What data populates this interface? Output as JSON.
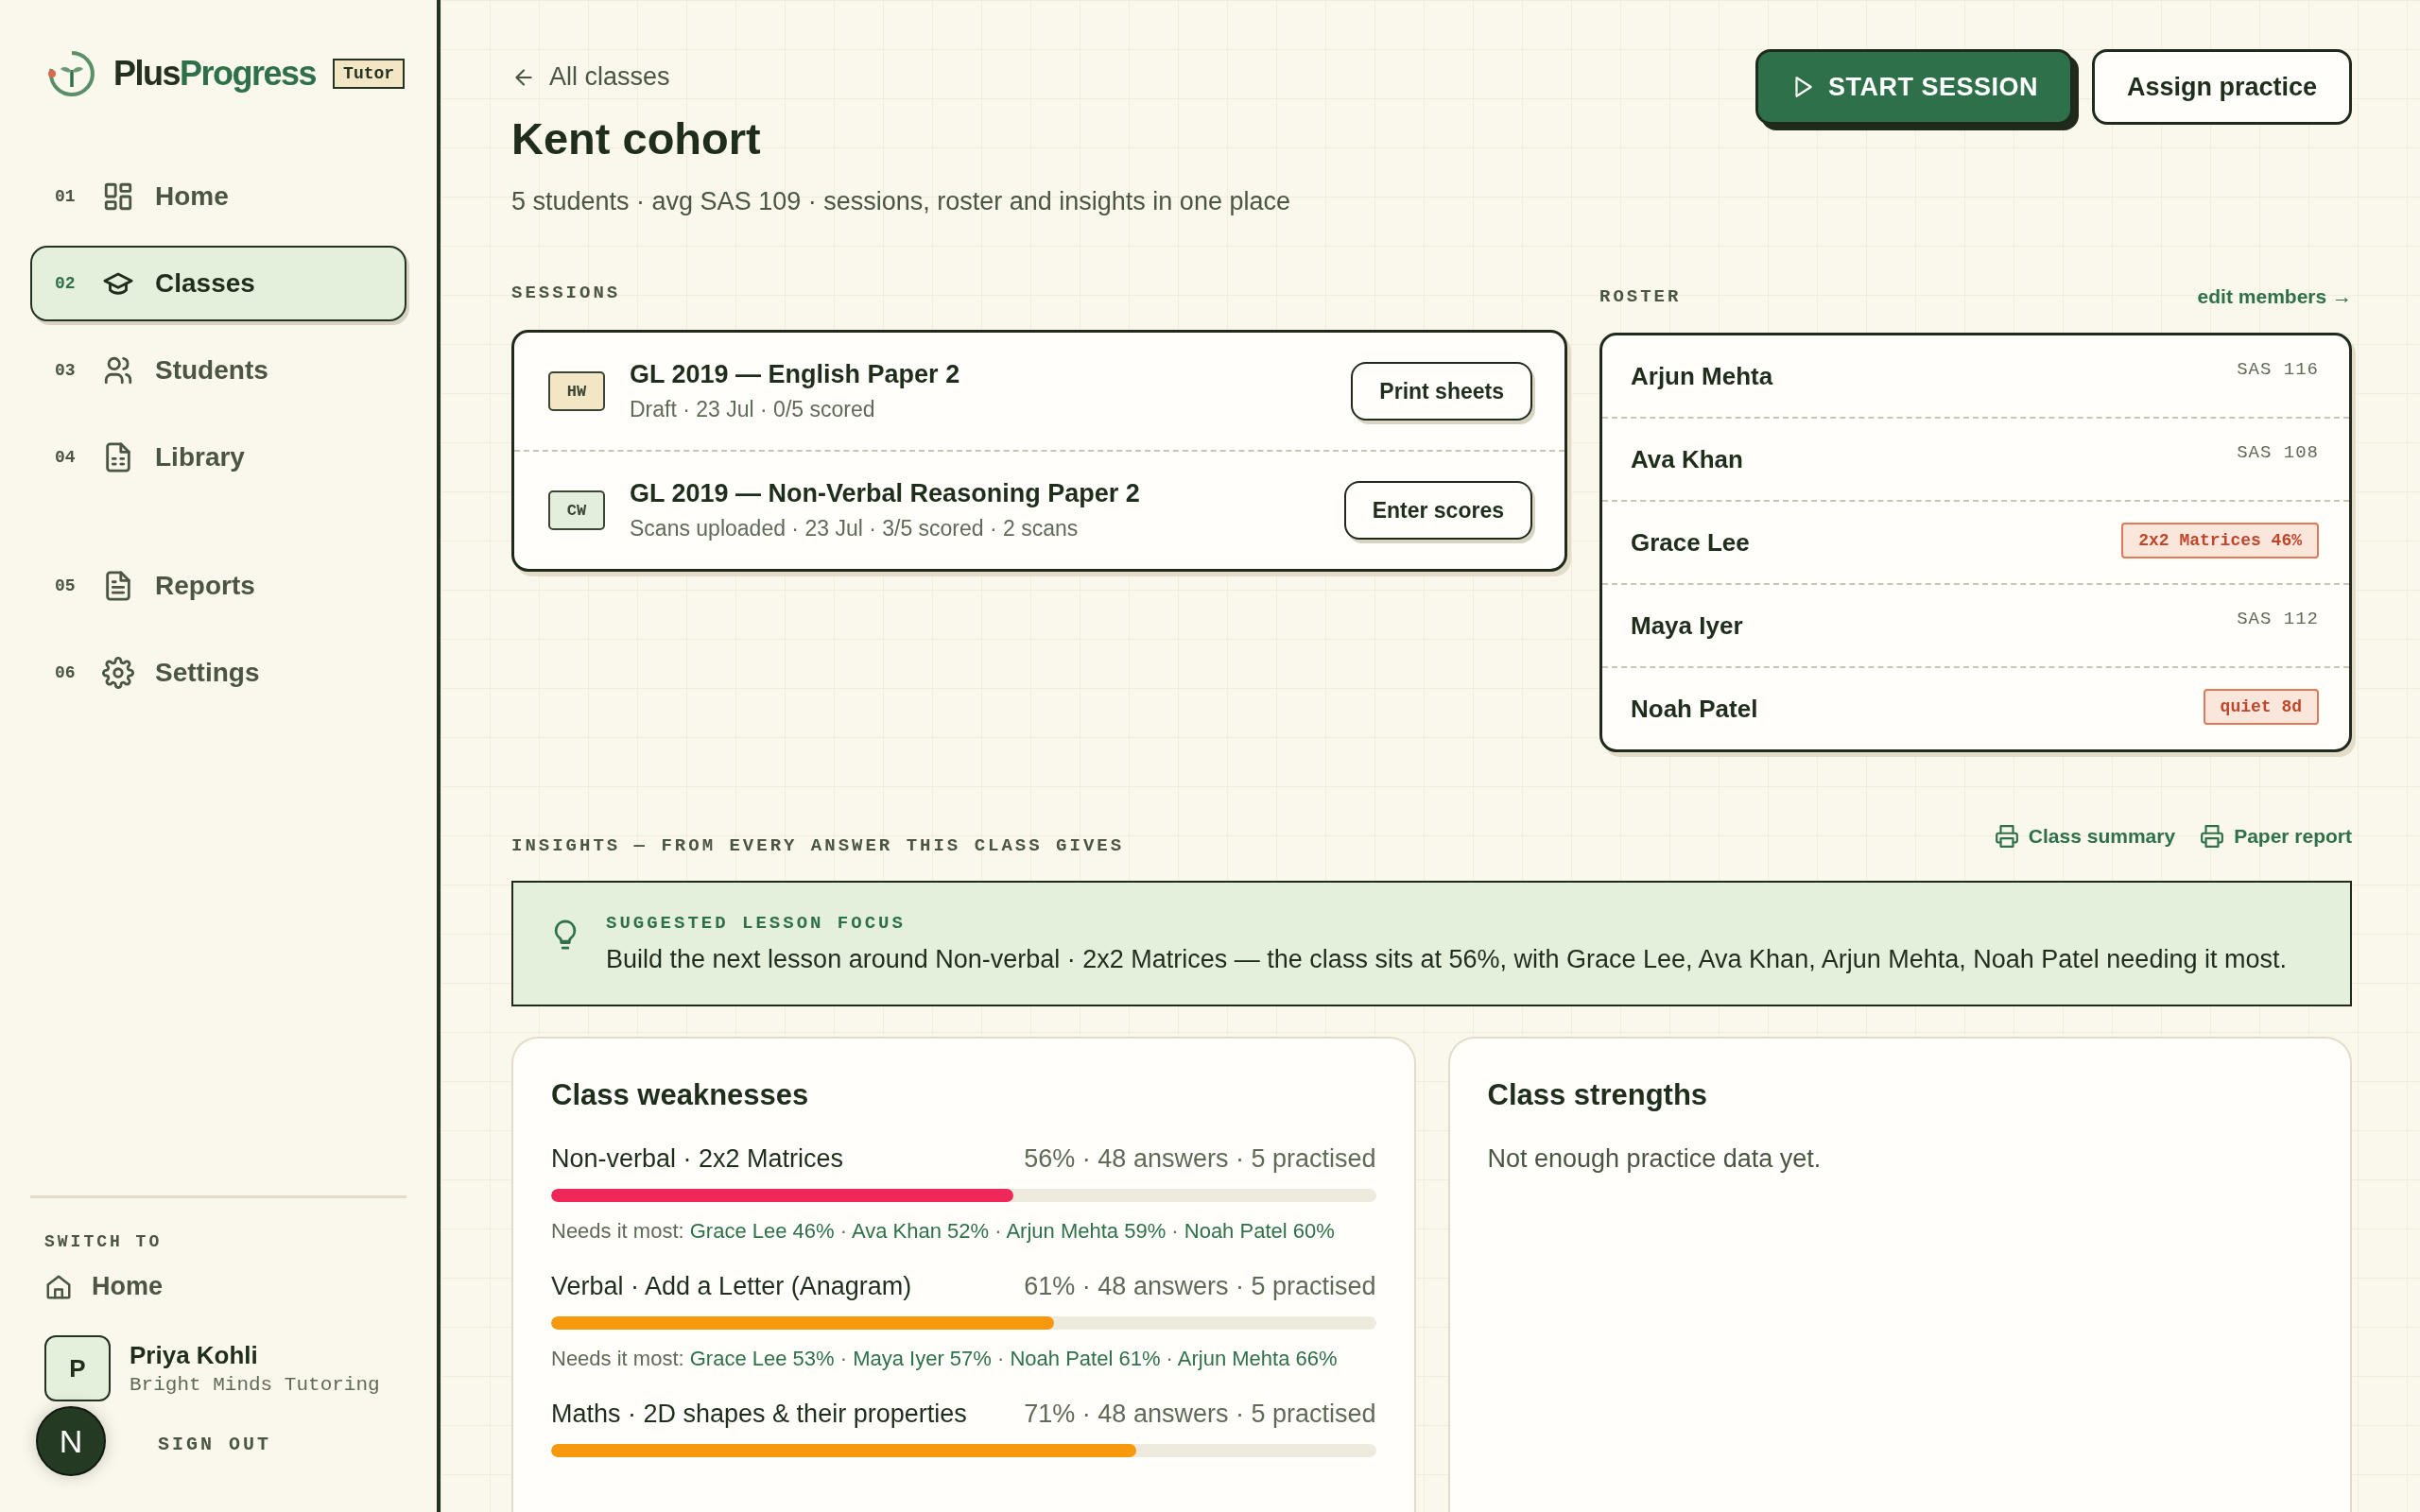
{
  "sidebar": {
    "brand": {
      "name_first": "Plus",
      "name_second": "Progress",
      "badge": "Tutor"
    },
    "nav": [
      {
        "number": "01",
        "label": "Home",
        "kind": "dashboard",
        "selected": false
      },
      {
        "number": "02",
        "label": "Classes",
        "kind": "classes",
        "selected": true
      },
      {
        "number": "03",
        "label": "Students",
        "kind": "students",
        "selected": false
      },
      {
        "number": "04",
        "label": "Library",
        "kind": "library",
        "selected": false
      },
      {
        "number": "05",
        "label": "Reports",
        "kind": "reports",
        "selected": false
      },
      {
        "number": "06",
        "label": "Settings",
        "kind": "settings",
        "selected": false
      }
    ],
    "switch_to": {
      "heading": "SWITCH TO",
      "label": "Home"
    },
    "user": {
      "initial": "P",
      "name": "Priya Kohli",
      "org": "Bright Minds Tutoring"
    },
    "sign_out": "SIGN OUT"
  },
  "dev_badge": "N",
  "header": {
    "back_link": "All classes",
    "title": "Kent cohort",
    "subtitle": "5 students · avg SAS 109 · sessions, roster and insights in one place",
    "primary_button": "START SESSION",
    "secondary_button": "Assign practice"
  },
  "sessions": {
    "heading": "SESSIONS",
    "items": [
      {
        "tag": "HW",
        "kind": "homework",
        "title": "GL 2019 — English Paper 2",
        "meta": "Draft · 23 Jul · 0/5 scored",
        "action": "Print sheets"
      },
      {
        "tag": "CW",
        "kind": "classwork",
        "title": "GL 2019 — Non-Verbal Reasoning Paper 2",
        "meta": "Scans uploaded · 23 Jul · 3/5 scored · 2 scans",
        "action": "Enter scores"
      }
    ]
  },
  "roster": {
    "heading": "ROSTER",
    "link": "edit members →",
    "members": [
      {
        "name": "Arjun Mehta",
        "kind": "score",
        "note": "SAS 116"
      },
      {
        "name": "Ava Khan",
        "kind": "score",
        "note": "SAS 108"
      },
      {
        "name": "Grace Lee",
        "kind": "alert",
        "note": "2x2 Matrices 46%"
      },
      {
        "name": "Maya Iyer",
        "kind": "score",
        "note": "SAS 112"
      },
      {
        "name": "Noah Patel",
        "kind": "alert",
        "note": "quiet 8d"
      }
    ]
  },
  "insights": {
    "heading": "INSIGHTS — FROM EVERY ANSWER THIS CLASS GIVES",
    "actions": [
      "Class summary",
      "Paper report"
    ],
    "focus": {
      "heading": "SUGGESTED LESSON FOCUS",
      "text": "Build the next lesson around Non-verbal · 2x2 Matrices — the class sits at 56%, with Grace Lee, Ava Khan, Arjun Mehta, Noah Patel needing it most."
    }
  },
  "weaknesses": {
    "title": "Class weaknesses",
    "items": [
      {
        "topic": "Non-verbal · 2x2 Matrices",
        "stats": "56% · 48 answers · 5 practised",
        "level": 0.56,
        "color": "#f0285a",
        "needs_label": "Needs it most:",
        "separator": "·",
        "students": [
          "Grace Lee 46%",
          "Ava Khan 52%",
          "Arjun Mehta 59%",
          "Noah Patel 60%"
        ]
      },
      {
        "topic": "Verbal · Add a Letter (Anagram)",
        "stats": "61% · 48 answers · 5 practised",
        "level": 0.61,
        "color": "#f7990c",
        "needs_label": "Needs it most:",
        "separator": "·",
        "students": [
          "Grace Lee 53%",
          "Maya Iyer 57%",
          "Noah Patel 61%",
          "Arjun Mehta 66%"
        ]
      },
      {
        "topic": "Maths · 2D shapes & their properties",
        "stats": "71% · 48 answers · 5 practised",
        "level": 0.71,
        "color": "#f7990c"
      }
    ]
  },
  "strengths": {
    "title": "Class strengths",
    "empty": "Not enough practice data yet."
  }
}
